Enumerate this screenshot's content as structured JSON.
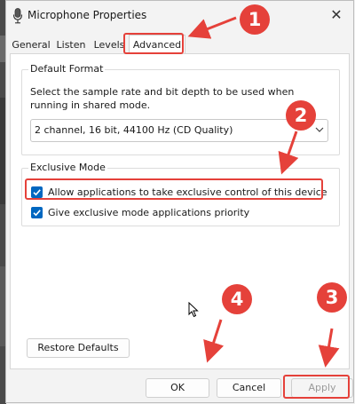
{
  "window": {
    "title": "Microphone Properties",
    "close_glyph": "✕"
  },
  "tabs": [
    {
      "label": "General"
    },
    {
      "label": "Listen"
    },
    {
      "label": "Levels"
    },
    {
      "label": "Advanced",
      "selected": true
    }
  ],
  "default_format": {
    "legend": "Default Format",
    "description": "Select the sample rate and bit depth to be used when running in shared mode.",
    "selected_value": "2 channel, 16 bit, 44100 Hz (CD Quality)"
  },
  "exclusive_mode": {
    "legend": "Exclusive Mode",
    "options": [
      {
        "label": "Allow applications to take exclusive control of this device",
        "checked": true
      },
      {
        "label": "Give exclusive mode applications priority",
        "checked": true
      }
    ]
  },
  "buttons": {
    "restore_defaults": "Restore Defaults",
    "ok": "OK",
    "cancel": "Cancel",
    "apply": "Apply"
  },
  "annotations": {
    "step_1": "1",
    "step_2": "2",
    "step_3": "3",
    "step_4": "4",
    "color": "#e5413a"
  },
  "colors": {
    "checkbox_accent": "#0067c0",
    "window_bg": "#f3f3f3",
    "panel_bg": "#ffffff"
  }
}
